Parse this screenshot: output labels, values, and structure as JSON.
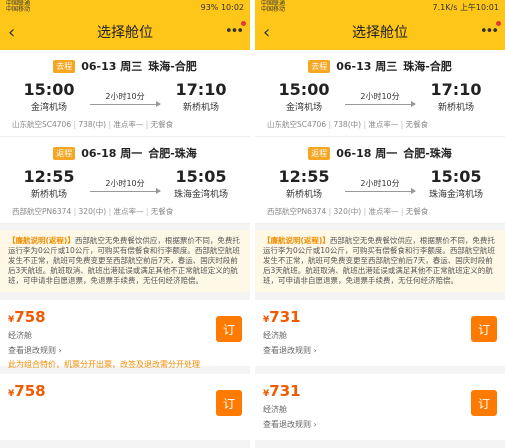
{
  "left": {
    "status": {
      "carrier": "中国联通",
      "carrier2": "中国移动",
      "battery": "93%",
      "time": "10:02"
    },
    "header": {
      "title": "选择舱位"
    },
    "outbound": {
      "tag": "去程",
      "date": "06-13 周三",
      "route": "珠海-合肥",
      "dep_time": "15:00",
      "dep_airport": "金湾机场",
      "duration": "2小时10分",
      "arr_time": "17:10",
      "arr_airport": "新桥机场",
      "flight": "山东航空SC4706",
      "aircraft": "738(中)",
      "ontime": "准点率—",
      "meal": "无餐食"
    },
    "return": {
      "tag": "返程",
      "date": "06-18 周一",
      "route": "合肥-珠海",
      "dep_time": "12:55",
      "dep_airport": "新桥机场",
      "duration": "2小时10分",
      "arr_time": "15:05",
      "arr_airport": "珠海金湾机场",
      "flight": "西部航空PN6374",
      "aircraft": "320(中)",
      "ontime": "准点率—",
      "meal": "无餐食"
    },
    "notice": {
      "label": "【廉航说明(返程)】",
      "text": "西部航空无免费餐饮供应，根据票价不同，免费托运行李为0公斤或10公斤，可购买有偿餐食和行李额度。西部航空航班发生不正常，航班可免费变更至西部航空前后7天，春运、国庆时段前后3天航班。航班取消、航班出港延误或满足其他不正常航班定义的航班，可申请非自愿退票，免退票手续费，无任何经济赔偿。"
    },
    "fares": [
      {
        "yen": "¥",
        "price": "758",
        "cabin": "经济舱",
        "rules": "查看退改规则",
        "promo": "此为组合特价，机票分开出票，改签及退改需分开处理",
        "book": "订"
      },
      {
        "yen": "¥",
        "price": "758",
        "cabin": "",
        "rules": "",
        "promo": "",
        "book": "订"
      }
    ]
  },
  "right": {
    "status": {
      "carrier": "中国联通",
      "carrier2": "中国移动",
      "net": "7.1K/s",
      "time": "上午10:01"
    },
    "header": {
      "title": "选择舱位"
    },
    "outbound": {
      "tag": "去程",
      "date": "06-13 周三",
      "route": "珠海-合肥",
      "dep_time": "15:00",
      "dep_airport": "金湾机场",
      "duration": "2小时10分",
      "arr_time": "17:10",
      "arr_airport": "新桥机场",
      "flight": "山东航空SC4706",
      "aircraft": "738(中)",
      "ontime": "准点率—",
      "meal": "无餐食"
    },
    "return": {
      "tag": "返程",
      "date": "06-18 周一",
      "route": "合肥-珠海",
      "dep_time": "12:55",
      "dep_airport": "新桥机场",
      "duration": "2小时10分",
      "arr_time": "15:05",
      "arr_airport": "珠海金湾机场",
      "flight": "西部航空PN6374",
      "aircraft": "320(中)",
      "ontime": "准点率—",
      "meal": "无餐食"
    },
    "notice": {
      "label": "【廉航说明(返程)】",
      "text": "西部航空无免费餐饮供应，根据票价不同，免费托运行李为0公斤或10公斤，可购买有偿餐食和行李额度。西部航空航班发生不正常，航班可免费变更至西部航空前后7天，春运、国庆时段前后3天航班。航班取消、航班出港延误或满足其他不正常航班定义的航班，可申请非自愿退票，免退票手续费，无任何经济赔偿。"
    },
    "fares": [
      {
        "yen": "¥",
        "price": "731",
        "cabin": "经济舱",
        "rules": "查看退改规则",
        "book": "订"
      },
      {
        "yen": "¥",
        "price": "731",
        "cabin": "经济舱",
        "rules": "查看退改规则",
        "book": "订"
      }
    ]
  }
}
